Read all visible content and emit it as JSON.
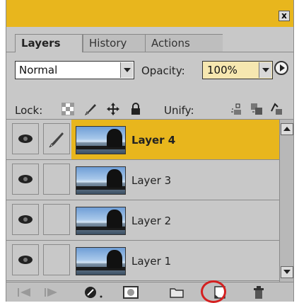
{
  "panel": {
    "tabs": [
      {
        "label": "Layers",
        "active": true
      },
      {
        "label": "History",
        "active": false
      },
      {
        "label": "Actions",
        "active": false
      }
    ],
    "close_label": "x"
  },
  "mode": {
    "blend_mode": "Normal",
    "opacity_label": "Opacity:",
    "opacity_value": "100%"
  },
  "lock": {
    "label": "Lock:",
    "unify_label": "Unify:"
  },
  "layers": [
    {
      "name": "Layer 4",
      "selected": true
    },
    {
      "name": "Layer 3",
      "selected": false
    },
    {
      "name": "Layer 2",
      "selected": false
    },
    {
      "name": "Layer 1",
      "selected": false
    }
  ],
  "colors": {
    "accent": "#e8b61d",
    "highlight_ring": "#d42020"
  },
  "icons": {
    "bottom_bar": [
      "prev-frame-icon",
      "next-frame-icon",
      "layer-style-icon",
      "add-mask-icon",
      "new-group-icon",
      "new-layer-icon",
      "trash-icon"
    ]
  }
}
